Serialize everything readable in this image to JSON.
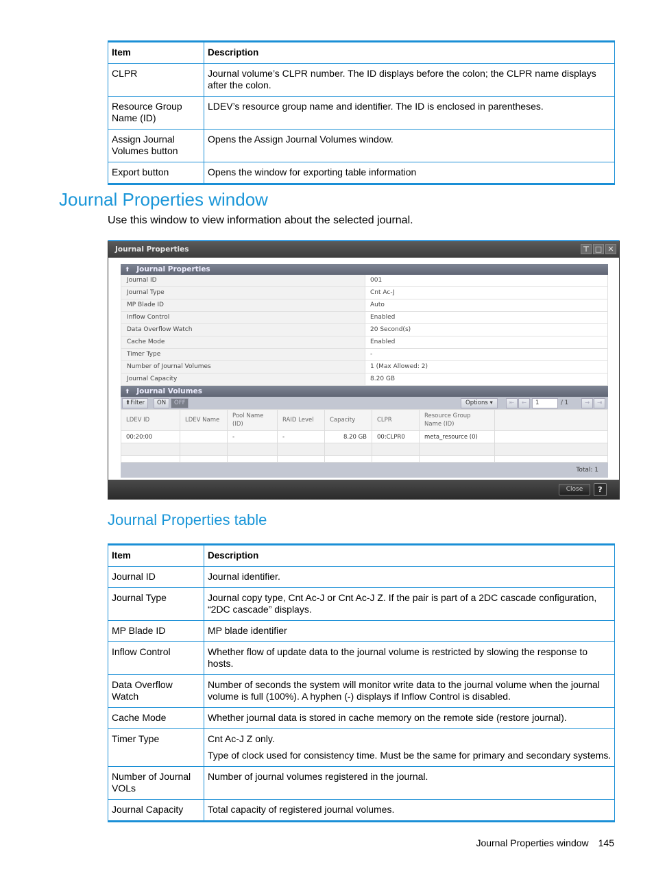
{
  "top_table": {
    "headers": [
      "Item",
      "Description"
    ],
    "rows": [
      {
        "item": "CLPR",
        "description": "Journal volume’s CLPR number. The ID displays before the colon; the CLPR name displays after the colon."
      },
      {
        "item": "Resource Group Name (ID)",
        "description": "LDEV’s resource group name and identifier. The ID is enclosed in parentheses."
      },
      {
        "item": "Assign Journal Volumes button",
        "description": "Opens the Assign Journal Volumes window."
      },
      {
        "item": "Export button",
        "description": "Opens the window for exporting table information"
      }
    ]
  },
  "section": {
    "title": "Journal Properties window",
    "intro": "Use this window to view information about the selected journal."
  },
  "window": {
    "title": "Journal Properties",
    "title_buttons": [
      {
        "icon": "pin-icon",
        "glyph": "⊤"
      },
      {
        "icon": "maximize-icon",
        "glyph": "□"
      },
      {
        "icon": "close-icon",
        "glyph": "✕"
      }
    ],
    "properties_panel": {
      "title": "Journal Properties",
      "collapse_glyph": "⬆",
      "rows": [
        {
          "key": "Journal ID",
          "value": "001"
        },
        {
          "key": "Journal Type",
          "value": "Cnt Ac-J"
        },
        {
          "key": "MP Blade ID",
          "value": "Auto"
        },
        {
          "key": "Inflow Control",
          "value": "Enabled"
        },
        {
          "key": "Data Overflow Watch",
          "value": "20 Second(s)"
        },
        {
          "key": "Cache Mode",
          "value": "Enabled"
        },
        {
          "key": "Timer Type",
          "value": "-"
        },
        {
          "key": "Number of Journal Volumes",
          "value": "1 (Max Allowed: 2)"
        },
        {
          "key": "Journal Capacity",
          "value": "8.20 GB"
        }
      ]
    },
    "volumes_panel": {
      "title": "Journal Volumes",
      "collapse_glyph": "⬆",
      "filter_label": "⬆Filter",
      "on_label": "ON",
      "off_label": "OFF",
      "options_label": "Options ▾",
      "first_glyph": "⇤",
      "prev_glyph": "←",
      "next_glyph": "→",
      "last_glyph": "⇥",
      "page_current": "1",
      "page_total": "/ 1",
      "columns": [
        "LDEV ID",
        "LDEV Name",
        "Pool Name (ID)",
        "RAID Level",
        "Capacity",
        "CLPR",
        "Resource Group Name (ID)",
        ""
      ],
      "rows": [
        [
          "00:20:00",
          "",
          "-",
          "-",
          "8.20 GB",
          "00:CLPR0",
          "meta_resource (0)",
          ""
        ]
      ],
      "total_label": "Total:  1"
    },
    "close_label": "Close",
    "help_label": "?"
  },
  "subsection": {
    "title": "Journal Properties table"
  },
  "props_table": {
    "headers": [
      "Item",
      "Description"
    ],
    "rows": [
      {
        "item": "Journal ID",
        "description": [
          "Journal identifier."
        ]
      },
      {
        "item": "Journal Type",
        "description": [
          "Journal copy type, Cnt Ac-J or Cnt Ac-J Z. If the pair is part of a 2DC cascade configuration, “2DC cascade” displays."
        ]
      },
      {
        "item": "MP Blade ID",
        "description": [
          "MP blade identifier"
        ]
      },
      {
        "item": "Inflow Control",
        "description": [
          "Whether flow of update data to the journal volume is restricted by slowing the response to hosts."
        ]
      },
      {
        "item": "Data Overflow Watch",
        "description": [
          "Number of seconds the system will monitor write data to the journal volume when the journal volume is full (100%). A hyphen (-) displays if Inflow Control is disabled."
        ]
      },
      {
        "item": "Cache Mode",
        "description": [
          "Whether journal data is stored in cache memory on the remote side (restore journal)."
        ]
      },
      {
        "item": "Timer Type",
        "description": [
          "Cnt Ac-J Z only.",
          "Type of clock used for consistency time. Must be the same for primary and secondary systems."
        ]
      },
      {
        "item": "Number of Journal VOLs",
        "description": [
          "Number of journal volumes registered in the journal."
        ]
      },
      {
        "item": "Journal Capacity",
        "description": [
          "Total capacity of registered journal volumes."
        ]
      }
    ]
  },
  "footer": {
    "section_name": "Journal Properties window",
    "page_number": "145"
  }
}
